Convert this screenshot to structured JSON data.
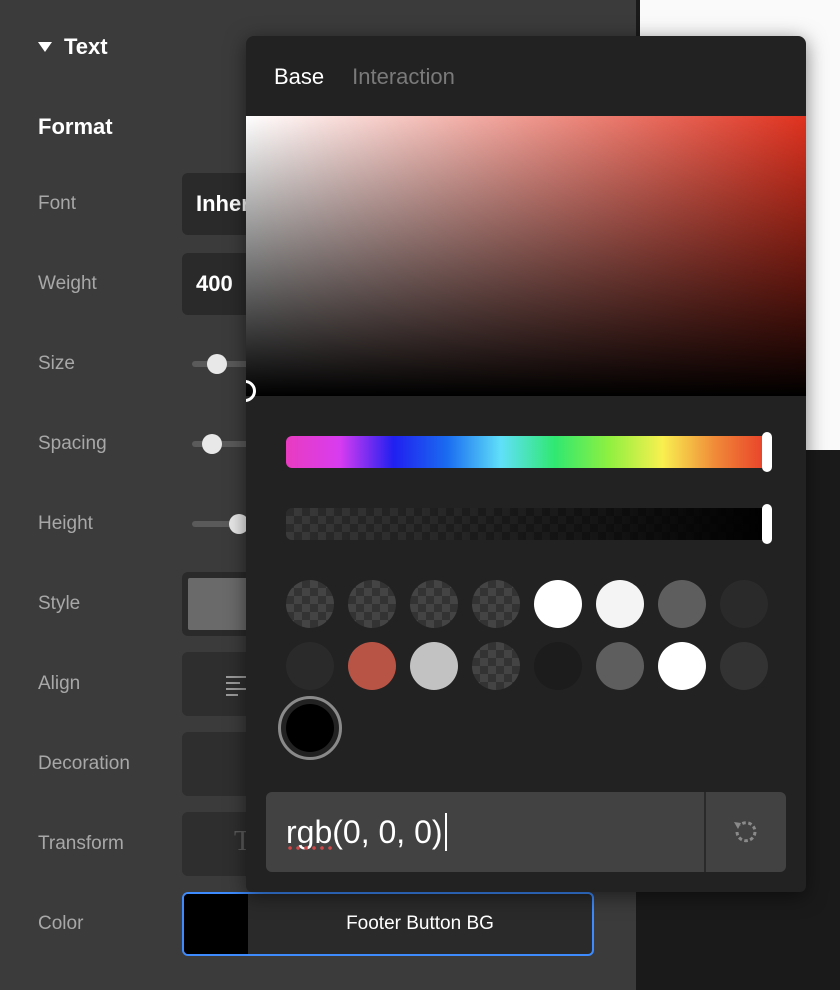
{
  "panel": {
    "section_title": "Text",
    "subsection_title": "Format",
    "rows": {
      "font_label": "Font",
      "font_value": "Inherit",
      "weight_label": "Weight",
      "weight_value": "400",
      "size_label": "Size",
      "spacing_label": "Spacing",
      "height_label": "Height",
      "style_label": "Style",
      "align_label": "Align",
      "decoration_label": "Decoration",
      "transform_label": "Transform",
      "transform_glyph": "T",
      "color_label": "Color",
      "color_value_name": "Footer Button BG"
    }
  },
  "picker": {
    "tabs": [
      "Base",
      "Interaction"
    ],
    "active_tab": "Base",
    "base_hue_color": "#e0321f",
    "hue_level": 1.0,
    "alpha_level": 1.0,
    "swatches": [
      {
        "color": "checker",
        "icon": "transparent-swatch"
      },
      {
        "color": "checker",
        "icon": "transparent-swatch"
      },
      {
        "color": "checker",
        "icon": "transparent-swatch"
      },
      {
        "color": "checker",
        "icon": "transparent-swatch"
      },
      {
        "color": "#ffffff"
      },
      {
        "color": "#f4f4f4"
      },
      {
        "color": "#5e5e5e"
      },
      {
        "color": "#2a2a2a"
      },
      {
        "color": "#2a2a2a"
      },
      {
        "color": "#b85446"
      },
      {
        "color": "#c2c2c2"
      },
      {
        "color": "checker",
        "icon": "transparent-swatch"
      },
      {
        "color": "#1c1c1c"
      },
      {
        "color": "#5e5e5e"
      },
      {
        "color": "#ffffff"
      },
      {
        "color": "#333333"
      }
    ],
    "selected_swatch_color": "#000000",
    "input_value": "rgb(0, 0, 0)",
    "reset_icon": "reset-icon"
  },
  "colors": {
    "accent": "#3d8bfd",
    "panel_bg": "#3b3b3b",
    "picker_bg": "#222222"
  }
}
